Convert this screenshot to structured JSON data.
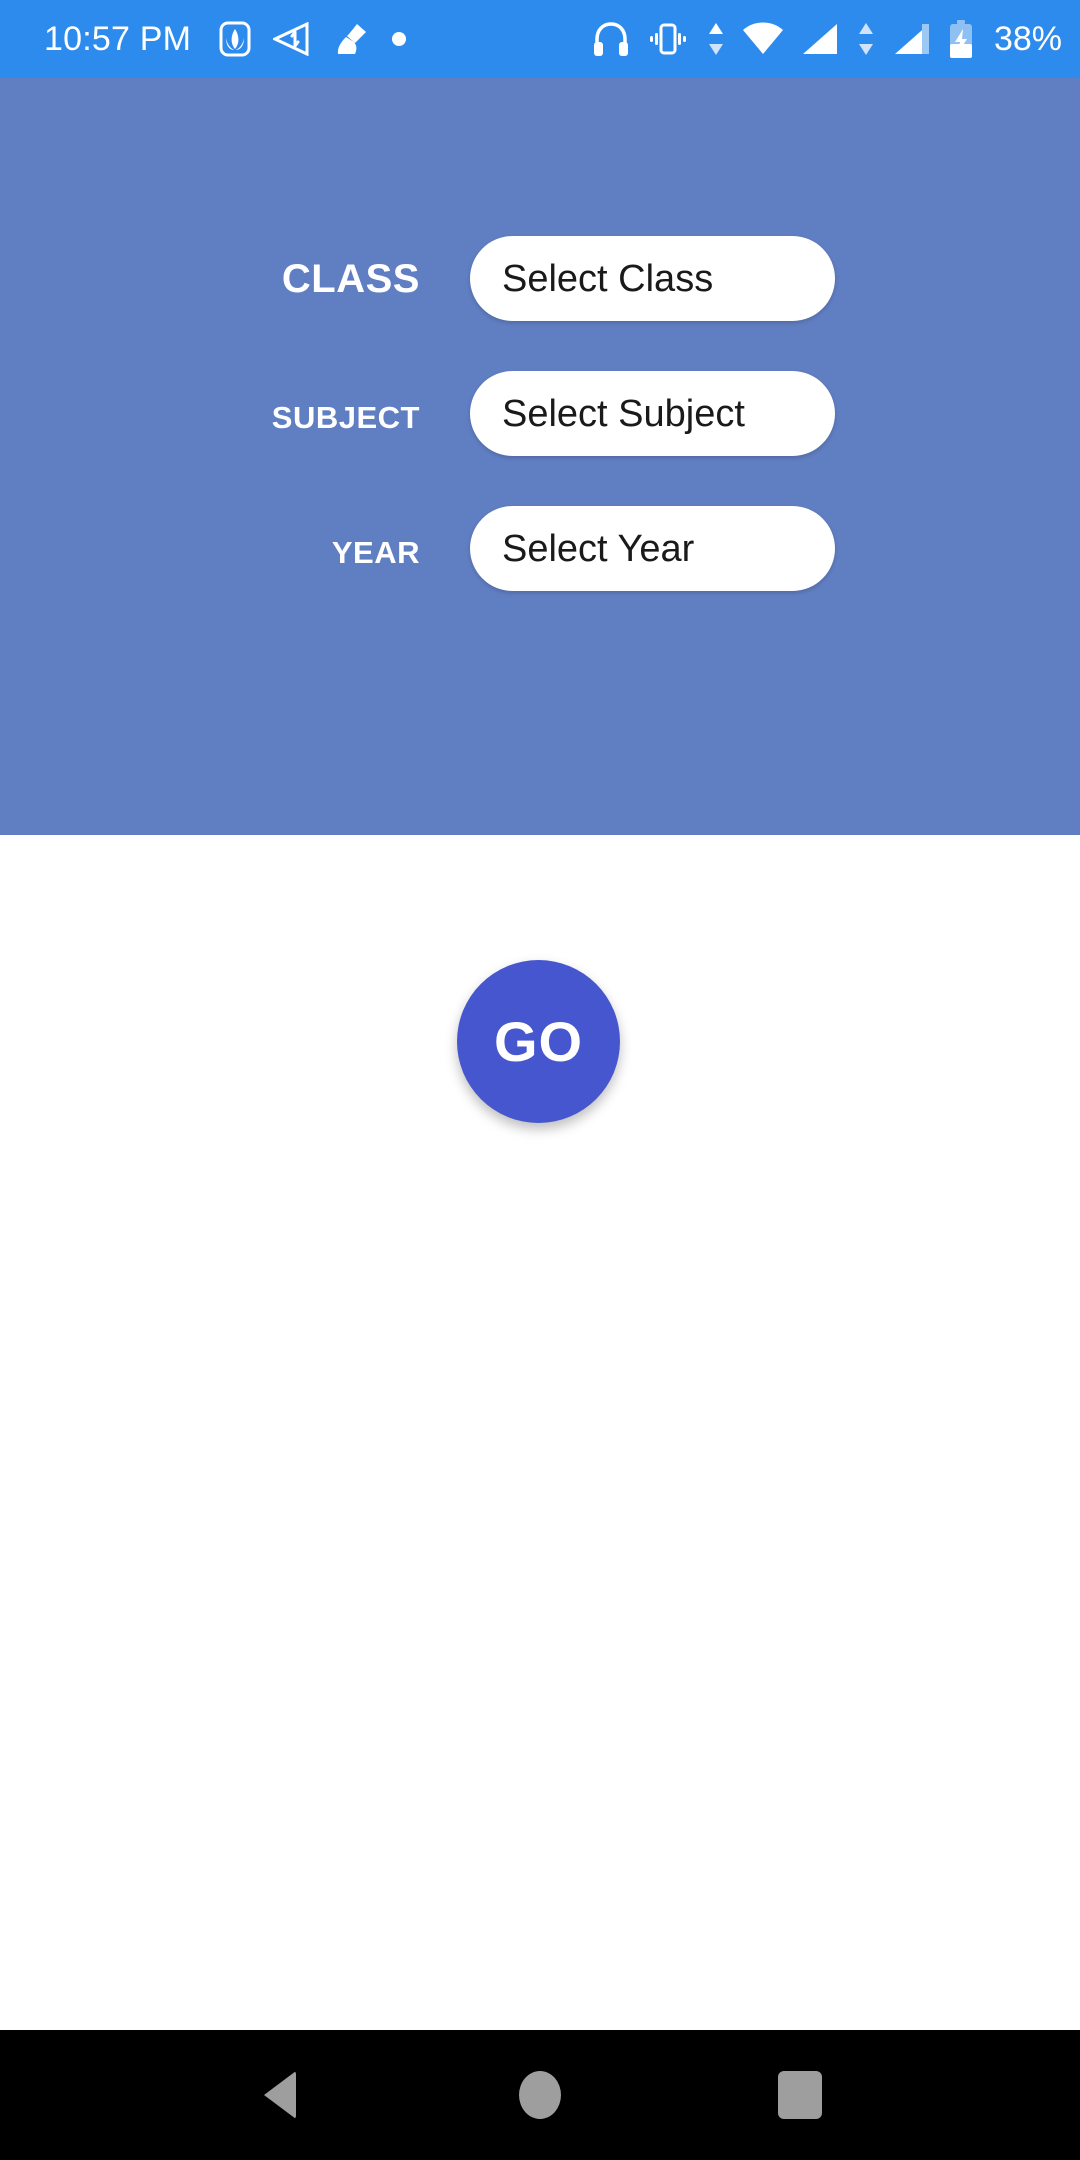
{
  "status_bar": {
    "clock": "10:57 PM",
    "battery_percent": "38%",
    "background_color": "#2E8BEE",
    "left_icons": [
      "app-notification-icon",
      "data-transfer-icon",
      "cleaner-broom-icon",
      "dot-notification-icon"
    ],
    "right_icons": [
      "headset-icon",
      "vibrate-icon",
      "mobile-data-arrows-icon",
      "wifi-icon",
      "signal-bars-1-icon",
      "mobile-data-arrows-2-icon",
      "signal-bars-2-icon",
      "battery-charging-icon"
    ]
  },
  "selector_panel": {
    "background_color": "#607EC2",
    "fields": [
      {
        "label": "Class",
        "value": "Select Class",
        "name": "class"
      },
      {
        "label": "Subject",
        "value": "Select Subject",
        "name": "subject"
      },
      {
        "label": "Year",
        "value": "Select Year",
        "name": "year"
      }
    ]
  },
  "content": {
    "go_button_label": "GO",
    "go_button_color": "#4656CE",
    "background_color": "#FFFFFF"
  },
  "nav_bar": {
    "background_color": "#000000",
    "icon_color": "#9E9E9E",
    "buttons": [
      {
        "name": "back-button",
        "icon": "triangle-left-icon"
      },
      {
        "name": "home-button",
        "icon": "circle-icon"
      },
      {
        "name": "recents-button",
        "icon": "square-icon"
      }
    ]
  }
}
